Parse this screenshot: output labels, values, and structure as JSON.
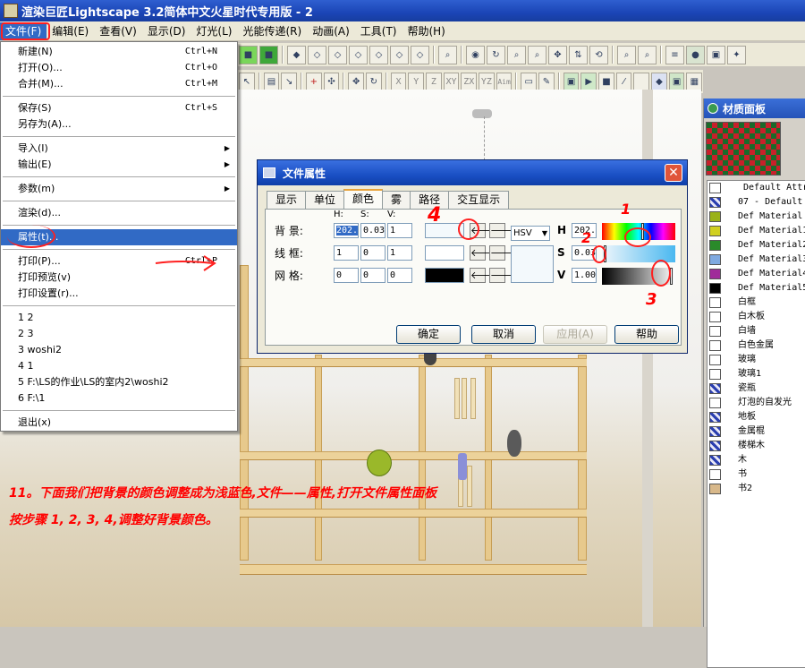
{
  "window": {
    "title": "渲染巨匠Lightscape 3.2简体中文火星时代专用版 - 2"
  },
  "menubar": [
    {
      "label": "文件(F)",
      "active": true
    },
    {
      "label": "编辑(E)"
    },
    {
      "label": "查看(V)"
    },
    {
      "label": "显示(D)"
    },
    {
      "label": "灯光(L)"
    },
    {
      "label": "光能传递(R)"
    },
    {
      "label": "动画(A)"
    },
    {
      "label": "工具(T)"
    },
    {
      "label": "帮助(H)"
    }
  ],
  "toolbar_axes": [
    "X",
    "Y",
    "Z",
    "XY",
    "ZX",
    "YZ",
    "Aim"
  ],
  "file_menu": {
    "new": {
      "label": "新建(N)",
      "shortcut": "Ctrl+N"
    },
    "open": {
      "label": "打开(O)...",
      "shortcut": "Ctrl+O"
    },
    "merge": {
      "label": "合并(M)...",
      "shortcut": "Ctrl+M"
    },
    "save": {
      "label": "保存(S)",
      "shortcut": "Ctrl+S"
    },
    "save_as": {
      "label": "另存为(A)..."
    },
    "import": {
      "label": "导入(I)"
    },
    "export": {
      "label": "输出(E)"
    },
    "params": {
      "label": "参数(m)"
    },
    "render": {
      "label": "渲染(d)..."
    },
    "properties": {
      "label": "属性(t)..."
    },
    "print": {
      "label": "打印(P)...",
      "shortcut": "Ctrl+P"
    },
    "print_preview": {
      "label": "打印预览(v)"
    },
    "print_setup": {
      "label": "打印设置(r)..."
    },
    "recent": [
      "1 2",
      "2 3",
      "3 woshi2",
      "4 1",
      "5 F:\\LS的作业\\LS的室内2\\woshi2",
      "6 F:\\1"
    ],
    "exit": {
      "label": "退出(x)"
    }
  },
  "dialog": {
    "title": "文件属性",
    "tabs": [
      "显示",
      "单位",
      "颜色",
      "雾",
      "路径",
      "交互显示"
    ],
    "active_tab": "颜色",
    "col_headers": {
      "h": "H:",
      "s": "S:",
      "v": "V:"
    },
    "rows": {
      "background": {
        "label": "背  景:",
        "h": "202.",
        "s": "0.03",
        "v": "1",
        "swatch": "#f3f9fc"
      },
      "wireframe": {
        "label": "线  框:",
        "h": "1",
        "s": "0",
        "v": "1",
        "swatch": "#ffffff"
      },
      "grid": {
        "label": "网  格:",
        "h": "0",
        "s": "0",
        "v": "0",
        "swatch": "#000000"
      }
    },
    "mode": "HSV",
    "h_label": "H",
    "s_label": "S",
    "v_label": "V",
    "h_value": "202.",
    "s_value": "0.03",
    "v_value": "1.00",
    "preview_color": "#f3f9fc",
    "buttons": {
      "ok": "确定",
      "cancel": "取消",
      "apply": "应用(A)",
      "help": "帮助"
    }
  },
  "material_panel": {
    "title": "材质面板",
    "items": [
      {
        "name": "Default Attr",
        "color": "#ffffff",
        "cube": false,
        "header": true
      },
      {
        "name": "07 - Default",
        "color": "",
        "cube": true
      },
      {
        "name": "Def Material",
        "color": "#9ab218"
      },
      {
        "name": "Def Material1",
        "color": "#d0d020"
      },
      {
        "name": "Def Material2",
        "color": "#2a8a2a"
      },
      {
        "name": "Def Material3",
        "color": "#7fa9e0"
      },
      {
        "name": "Def Material4",
        "color": "#a02a9a"
      },
      {
        "name": "Def Material5",
        "color": "#000000"
      },
      {
        "name": "白框",
        "color": "#ffffff"
      },
      {
        "name": "白木板",
        "color": "#ffffff"
      },
      {
        "name": "白墙",
        "color": "#ffffff"
      },
      {
        "name": "白色金属",
        "color": "#ffffff"
      },
      {
        "name": "玻璃",
        "color": "#ffffff"
      },
      {
        "name": "玻璃1",
        "color": "#ffffff"
      },
      {
        "name": "瓷瓶",
        "color": "",
        "cube": true
      },
      {
        "name": "灯泡的自发光",
        "color": "#ffffff"
      },
      {
        "name": "地板",
        "color": "",
        "cube": true
      },
      {
        "name": "金属棍",
        "color": "",
        "cube": true
      },
      {
        "name": "楼梯木",
        "color": "",
        "cube": true
      },
      {
        "name": "木",
        "color": "",
        "cube": true
      },
      {
        "name": "书",
        "color": "#ffffff"
      },
      {
        "name": "书2",
        "color": "#d8b88a"
      }
    ]
  },
  "annotations": {
    "line1": "11。下面我们把背景的颜色调整成为浅蓝色,文件——属性,打开文件属性面板",
    "line2": "按步骤 1,  2,  3,  4,调整好背景颜色。",
    "n1": "1",
    "n2": "2",
    "n3": "3",
    "n4": "4"
  },
  "colors": {
    "annotation": "#ff0000",
    "highlight": "#316ac5"
  }
}
